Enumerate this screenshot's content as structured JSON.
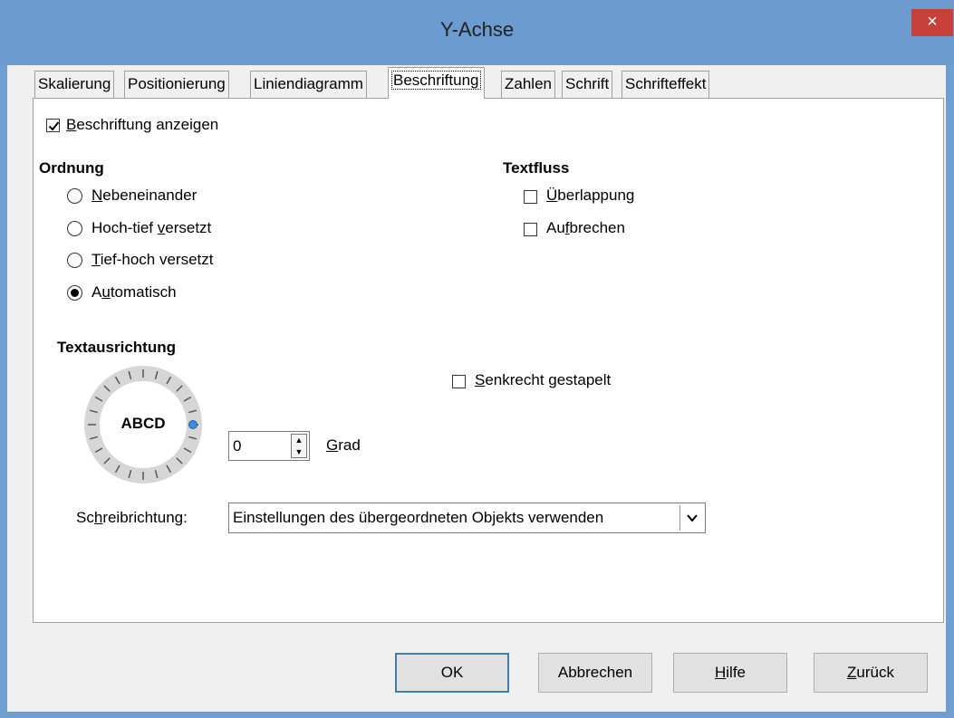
{
  "window": {
    "title": "Y-Achse",
    "close_glyph": "×"
  },
  "tabs": [
    {
      "label": "Skalierung",
      "active": false
    },
    {
      "label": "Positionierung",
      "active": false
    },
    {
      "label": "Liniendiagramm",
      "active": false
    },
    {
      "label": "Beschriftung",
      "active": true
    },
    {
      "label": "Zahlen",
      "active": false
    },
    {
      "label": "Schrift",
      "active": false
    },
    {
      "label": "Schrifteffekt",
      "active": false
    }
  ],
  "show_labels": {
    "label_u": "B",
    "label_rest": "eschriftung anzeigen",
    "checked": true
  },
  "order": {
    "heading": "Ordnung",
    "options": [
      {
        "pre": "",
        "u": "N",
        "post": "ebeneinander",
        "selected": false
      },
      {
        "pre": "Hoch-tief ",
        "u": "v",
        "post": "ersetzt",
        "selected": false
      },
      {
        "pre": "",
        "u": "T",
        "post": "ief-hoch versetzt",
        "selected": false
      },
      {
        "pre": "A",
        "u": "u",
        "post": "tomatisch",
        "selected": true
      }
    ]
  },
  "textflow": {
    "heading": "Textfluss",
    "options": [
      {
        "pre": "",
        "u": "Ü",
        "post": "berlappung",
        "checked": false
      },
      {
        "pre": "Au",
        "u": "f",
        "post": "brechen",
        "checked": false
      }
    ]
  },
  "text_orientation": {
    "heading": "Textausrichtung",
    "dial_label": "ABCD",
    "stacked": {
      "u": "S",
      "post": "enkrecht gestapelt",
      "checked": false
    },
    "degrees_value": "0",
    "degrees_unit_u": "G",
    "degrees_unit_post": "rad"
  },
  "writing_direction": {
    "label_pre": "Sc",
    "label_u": "h",
    "label_post": "reibrichtung:",
    "value": "Einstellungen des übergeordneten Objekts verwenden"
  },
  "buttons": {
    "ok": "OK",
    "cancel": "Abbrechen",
    "help_u": "H",
    "help_post": "ilfe",
    "back_u": "Z",
    "back_post": "urück"
  },
  "colors": {
    "titlebar": "#6b9bcf",
    "close": "#c7403a",
    "dial_marker": "#3c8ee0"
  }
}
